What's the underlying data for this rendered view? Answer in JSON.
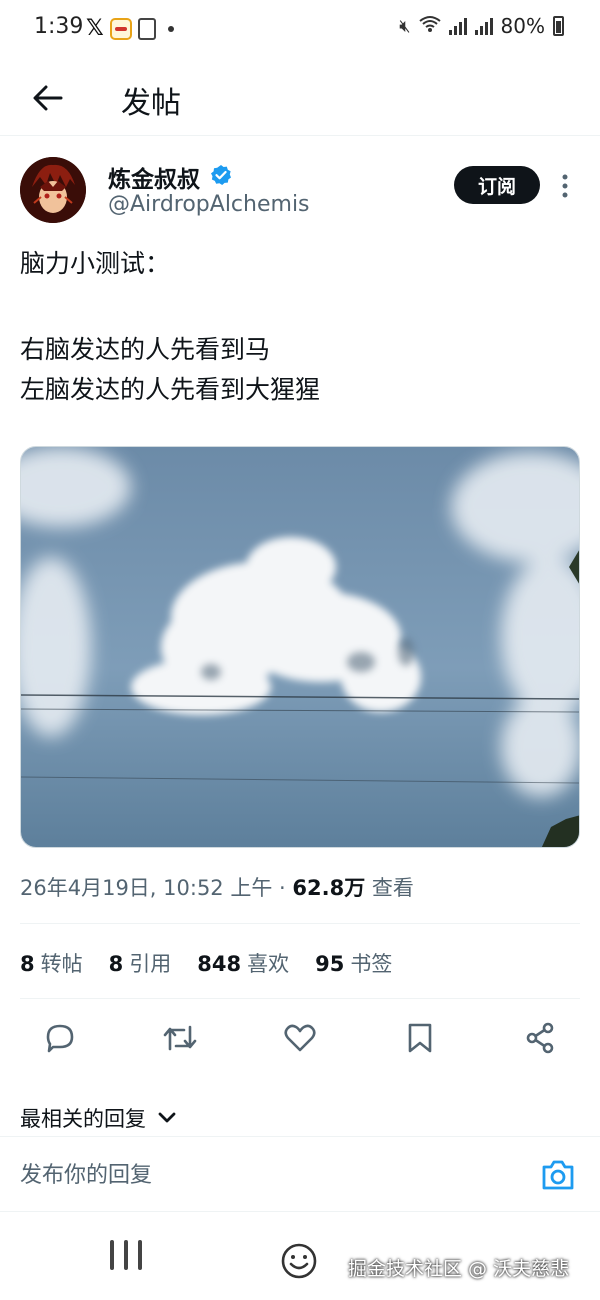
{
  "status_bar": {
    "time": "1:39",
    "battery": "80%",
    "icons": [
      "x-logo-icon",
      "app-badge-icon",
      "document-icon",
      "dot-icon",
      "mute-icon",
      "wifi-icon",
      "signal-icon",
      "battery-icon"
    ]
  },
  "header": {
    "title": "发帖",
    "back_icon": "arrow-left-icon"
  },
  "author": {
    "name": "炼金叔叔",
    "handle": "@AirdropAlchemis",
    "verified": true,
    "subscribe_label": "订阅"
  },
  "tweet": {
    "lines": [
      "脑力小测试：",
      "",
      "右脑发达的人先看到马",
      "左脑发达的人先看到大猩猩"
    ],
    "meta_prefix": "26年4月19日, 10:52 上午 · ",
    "views_count": "62.8万",
    "views_label": " 查看"
  },
  "stats": [
    {
      "count": "8",
      "label": "转帖"
    },
    {
      "count": "8",
      "label": "引用"
    },
    {
      "count": "848",
      "label": "喜欢"
    },
    {
      "count": "95",
      "label": "书签"
    }
  ],
  "actions": [
    "reply-icon",
    "retweet-icon",
    "like-icon",
    "bookmark-icon",
    "share-icon"
  ],
  "replies": {
    "sort_label": "最相关的回复"
  },
  "composer": {
    "placeholder": "发布你的回复"
  },
  "watermark": "掘金技术社区 @ 沃夫慈悲",
  "colors": {
    "text": "#0f1419",
    "secondary": "#536471",
    "accent": "#1d9bf0",
    "subscribe_bg": "#0f1419"
  }
}
